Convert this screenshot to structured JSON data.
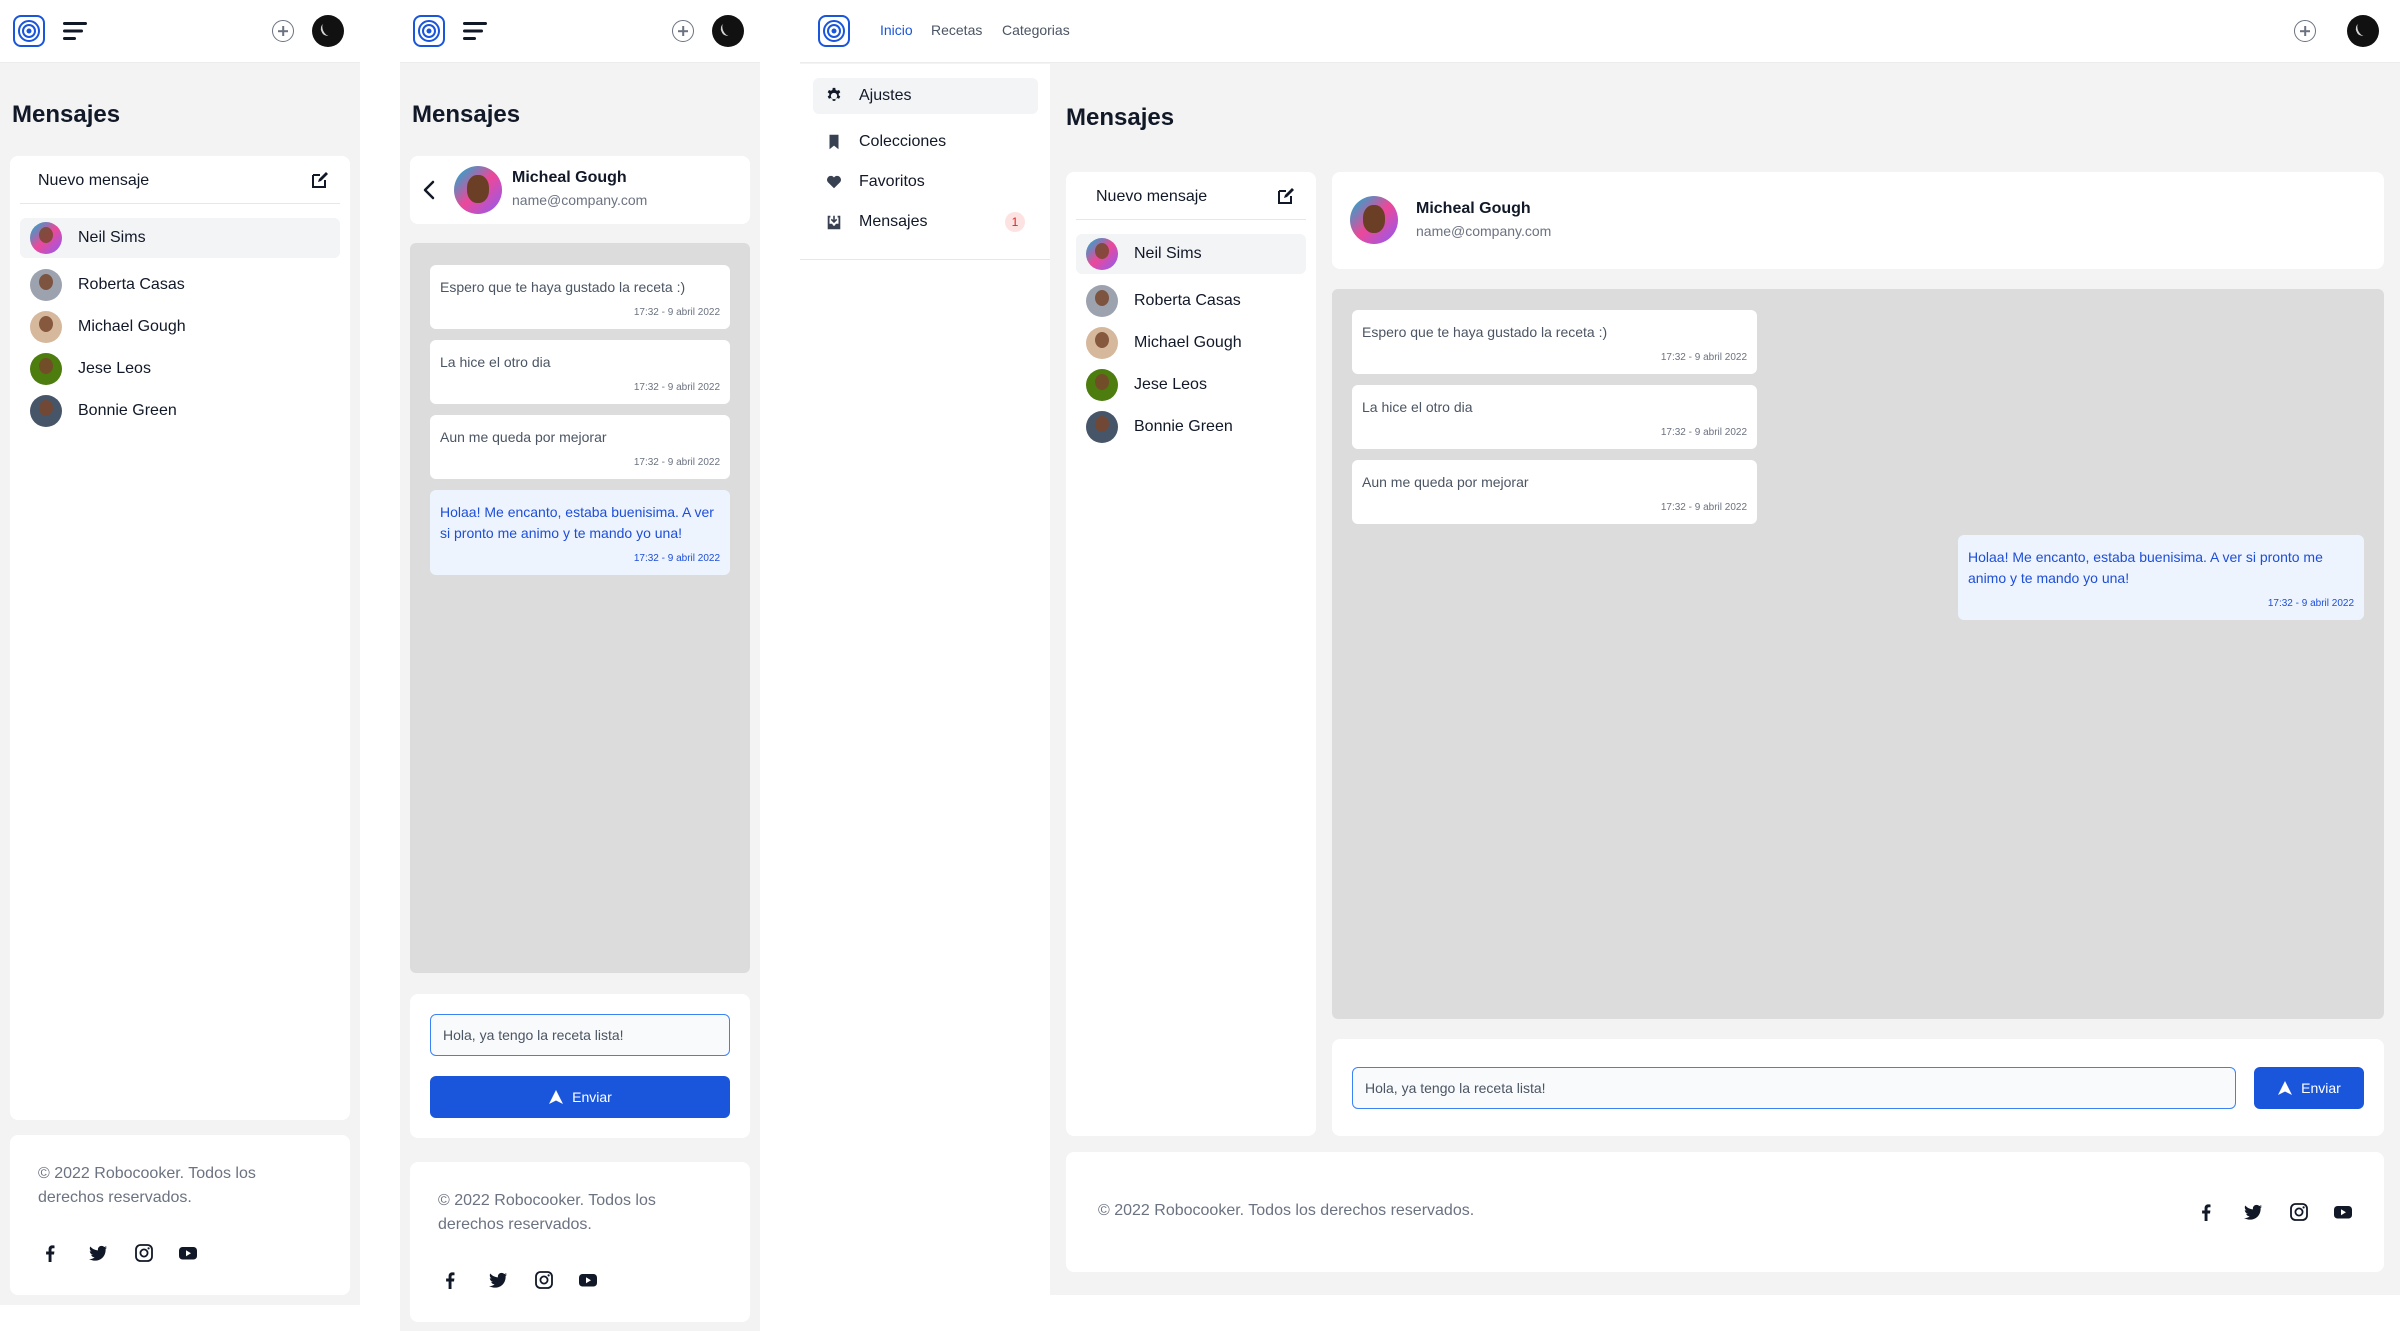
{
  "page_title": "Mensajes",
  "nav": {
    "links": [
      "Inicio",
      "Recetas",
      "Categorias"
    ]
  },
  "sidebar_menu": {
    "items": [
      {
        "label": "Ajustes",
        "icon": "gear-icon"
      },
      {
        "label": "Colecciones",
        "icon": "bookmark-icon"
      },
      {
        "label": "Favoritos",
        "icon": "heart-icon"
      },
      {
        "label": "Mensajes",
        "icon": "inbox-icon",
        "badge": "1"
      }
    ]
  },
  "contacts": {
    "new_message_label": "Nuevo mensaje",
    "items": [
      {
        "name": "Neil Sims",
        "active": true
      },
      {
        "name": "Roberta Casas"
      },
      {
        "name": "Michael Gough"
      },
      {
        "name": "Jese Leos"
      },
      {
        "name": "Bonnie Green"
      }
    ]
  },
  "chat": {
    "name": "Micheal Gough",
    "email": "name@company.com",
    "messages": [
      {
        "text": "Espero que te haya gustado la receta :)",
        "time": "17:32 - 9 abril 2022",
        "mine": false
      },
      {
        "text": "La hice el otro dia",
        "time": "17:32 - 9 abril 2022",
        "mine": false
      },
      {
        "text": "Aun me queda por mejorar",
        "time": "17:32 - 9 abril 2022",
        "mine": false
      },
      {
        "text": "Holaa! Me encanto, estaba buenisima. A ver si pronto me animo y te mando yo una!",
        "time": "17:32 - 9 abril 2022",
        "mine": true
      }
    ],
    "input_value": "Hola, ya tengo la receta lista!",
    "send_label": "Enviar"
  },
  "footer": {
    "copyright": "© 2022 Robocooker. Todos los derechos reservados.",
    "copyright_line1": "© 2022 Robocooker. Todos los",
    "copyright_line2": "derechos reservados.",
    "social": [
      "facebook-icon",
      "twitter-icon",
      "instagram-icon",
      "youtube-icon"
    ]
  },
  "colors": {
    "accent": "#1a56db",
    "background": "#f3f3f3",
    "badge": "#dc2626"
  }
}
